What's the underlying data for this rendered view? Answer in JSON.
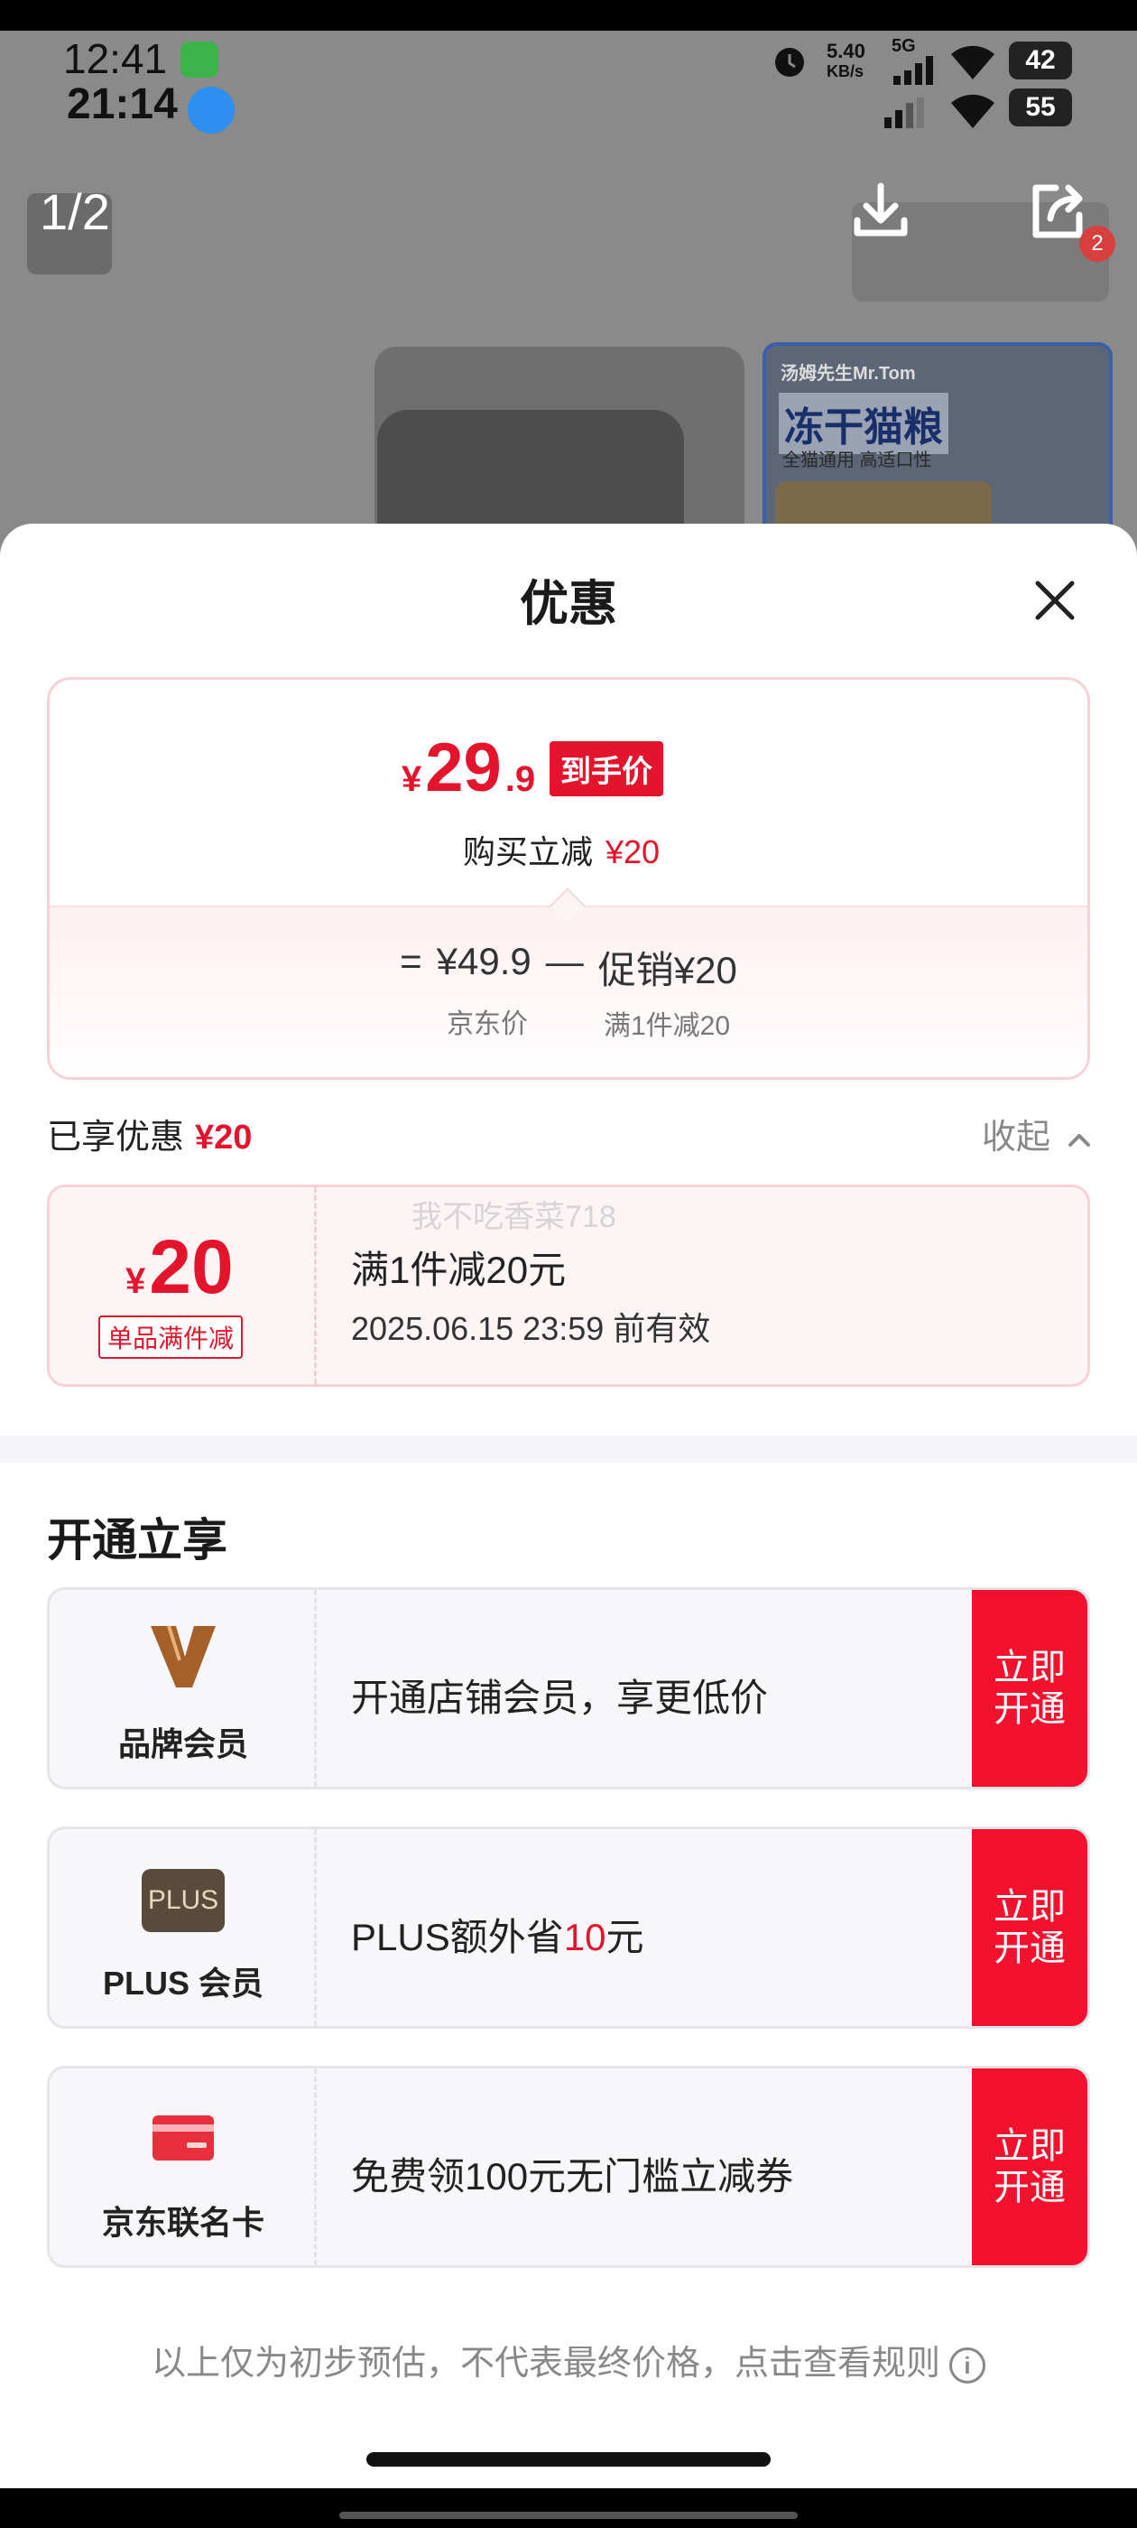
{
  "status_bar": {
    "time_primary": "12:41",
    "time_secondary": "21:14",
    "network_speed_value": "5.40",
    "network_speed_unit": "KB/s",
    "network_type": "5G",
    "battery_primary": "42",
    "battery_secondary": "55"
  },
  "viewer": {
    "page_indicator": "1/2",
    "badge_count": "2",
    "product_brand": "汤姆先生Mr.Tom",
    "product_title": "冻干猫粮",
    "product_sub": "全猫通用 高适口性"
  },
  "sheet": {
    "title": "优惠",
    "price_card": {
      "currency": "¥",
      "final_int": "29",
      "final_dec": ".9",
      "final_tag": "到手价",
      "buy_minus_label": "购买立减",
      "buy_minus_value": "¥20",
      "formula_eq": "=",
      "formula_base": "¥49.9",
      "formula_minus": "—",
      "formula_promo": "促销¥20",
      "base_label": "京东价",
      "promo_label": "满1件减20"
    },
    "enjoyed": {
      "label": "已享优惠",
      "value": "¥20",
      "collapse_label": "收起"
    },
    "coupon": {
      "currency": "¥",
      "amount": "20",
      "type": "单品满件减",
      "title": "满1件减20元",
      "validity": "2025.06.15 23:59 前有效"
    },
    "watermark": "我不吃香菜718",
    "membership": {
      "section_title": "开通立享",
      "items": [
        {
          "name": "品牌会员",
          "desc": "开通店铺会员，享更低价",
          "cta": "立即开通",
          "icon": "brand-v-icon"
        },
        {
          "name": "PLUS 会员",
          "desc_prefix": "PLUS额外省",
          "desc_highlight": "10",
          "desc_suffix": "元",
          "cta": "立即开通",
          "icon": "plus-badge-icon",
          "icon_text": "PLUS"
        },
        {
          "name": "京东联名卡",
          "desc": "免费领100元无门槛立减券",
          "cta": "立即开通",
          "icon": "credit-card-icon"
        }
      ]
    },
    "disclaimer": "以上仅为初步预估，不代表最终价格，点击查看规则"
  },
  "colors": {
    "accent_red": "#e3142b",
    "cta_red": "#f3122e"
  }
}
